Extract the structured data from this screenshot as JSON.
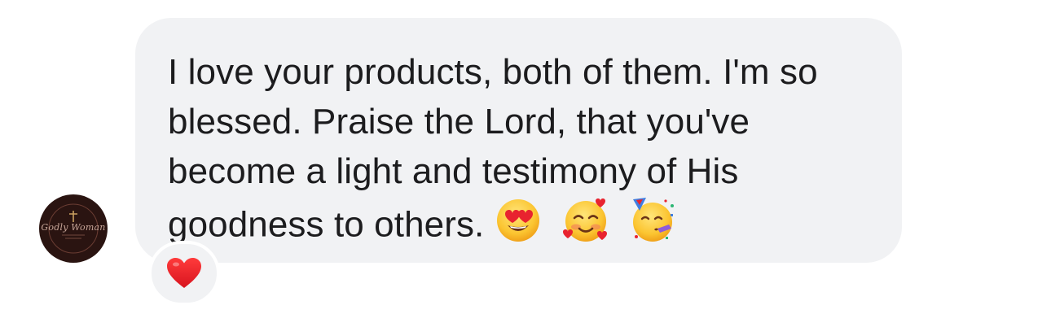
{
  "avatar": {
    "label": "Godly Woman"
  },
  "message": {
    "text": "I love your products, both of them. I'm so blessed. Praise the Lord, that you've become a light and testimony of His goodness to others.",
    "emojis": [
      "smiling-face-with-heart-eyes",
      "smiling-face-with-hearts",
      "partying-face"
    ]
  },
  "reaction": {
    "icon": "red-heart",
    "color": "#e0242b"
  },
  "colors": {
    "bubble_bg": "#f1f2f4",
    "text": "#1c1c1e",
    "avatar_bg": "#2a1411"
  }
}
